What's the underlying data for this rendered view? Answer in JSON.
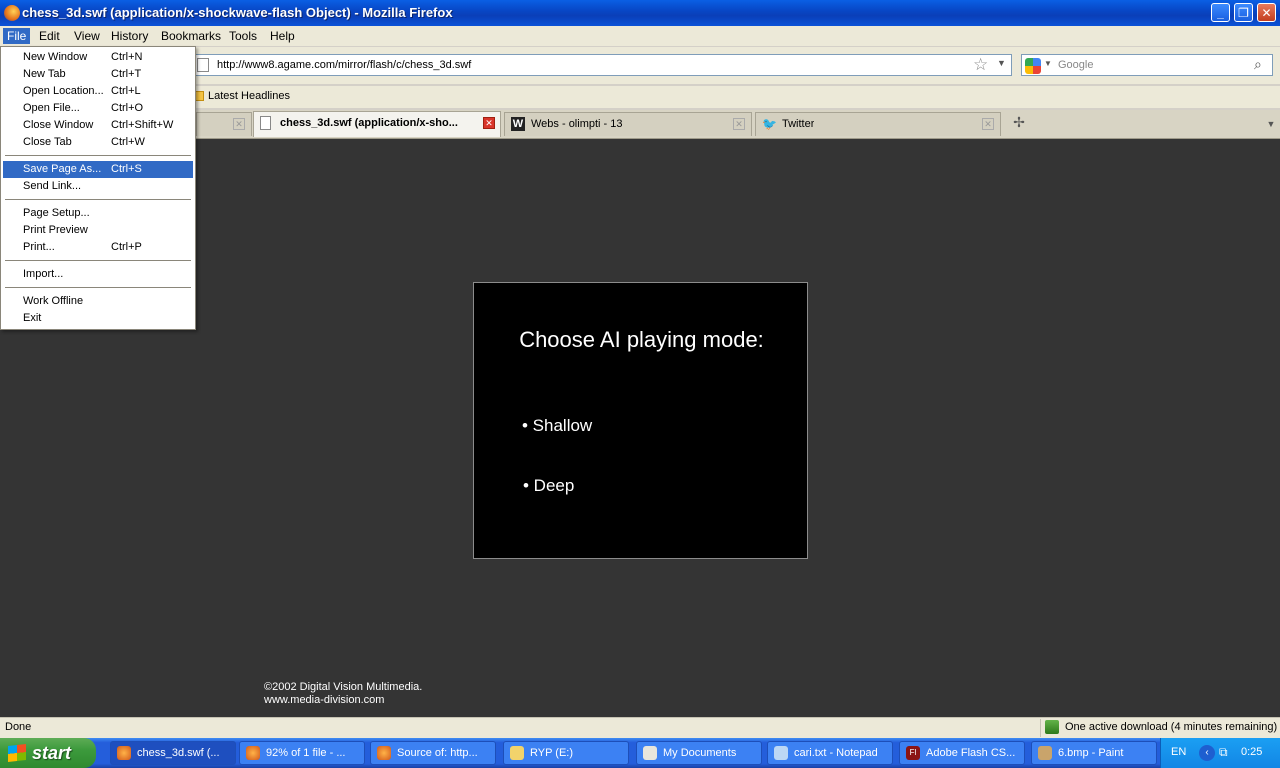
{
  "window": {
    "title": "chess_3d.swf (application/x-shockwave-flash Object) - Mozilla Firefox",
    "minimize": "_",
    "maximize": "❐",
    "close": "✕"
  },
  "menubar": [
    "File",
    "Edit",
    "View",
    "History",
    "Bookmarks",
    "Tools",
    "Help"
  ],
  "file_menu": [
    {
      "label": "New Window",
      "shortcut": "Ctrl+N"
    },
    {
      "label": "New Tab",
      "shortcut": "Ctrl+T"
    },
    {
      "label": "Open Location...",
      "shortcut": "Ctrl+L"
    },
    {
      "label": "Open File...",
      "shortcut": "Ctrl+O"
    },
    {
      "label": "Close Window",
      "shortcut": "Ctrl+Shift+W"
    },
    {
      "label": "Close Tab",
      "shortcut": "Ctrl+W"
    },
    {
      "label": "Save Page As...",
      "shortcut": "Ctrl+S"
    },
    {
      "label": "Send Link...",
      "shortcut": ""
    },
    {
      "label": "Page Setup...",
      "shortcut": ""
    },
    {
      "label": "Print Preview",
      "shortcut": ""
    },
    {
      "label": "Print...",
      "shortcut": "Ctrl+P"
    },
    {
      "label": "Import...",
      "shortcut": ""
    },
    {
      "label": "Work Offline",
      "shortcut": ""
    },
    {
      "label": "Exit",
      "shortcut": ""
    }
  ],
  "urlbar": {
    "url": "http://www8.agame.com/mirror/flash/c/chess_3d.swf"
  },
  "search": {
    "placeholder": "Google"
  },
  "bookmarks": [
    {
      "label": "Latest Headlines"
    }
  ],
  "tabs": [
    {
      "label": ""
    },
    {
      "label": "chess_3d.swf (application/x-sho..."
    },
    {
      "label": "Webs - olimpti - 13"
    },
    {
      "label": "Twitter"
    }
  ],
  "flash": {
    "heading": "Choose AI playing mode:",
    "options": [
      "• Shallow",
      "• Deep"
    ]
  },
  "credits": [
    "©2002 Digital Vision Multimedia.",
    "www.media-division.com"
  ],
  "status": {
    "left": "Done",
    "download": "One active download (4 minutes remaining)"
  },
  "taskbar": {
    "start": "start",
    "tasks": [
      "chess_3d.swf (...",
      "92% of 1 file - ...",
      "Source of: http...",
      "RYP (E:)",
      "My Documents",
      "cari.txt - Notepad",
      "Adobe Flash CS...",
      "6.bmp - Paint"
    ],
    "lang": "EN",
    "clock": "0:25"
  },
  "colors": {
    "content_bg": "#343434",
    "menu_highlight": "#316ac5",
    "titlebar": "#0a5fe4"
  }
}
